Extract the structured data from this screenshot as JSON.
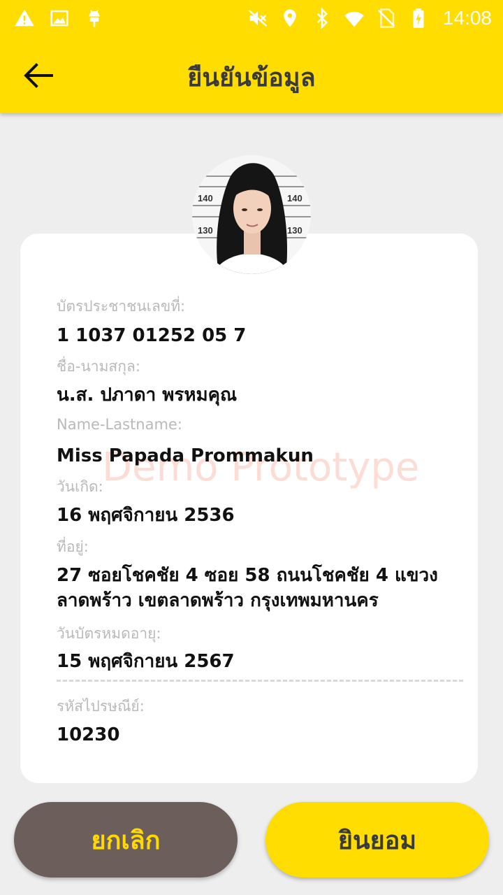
{
  "status_bar": {
    "time": "14:08",
    "left_icons": [
      "warning-icon",
      "image-icon",
      "android-icon"
    ],
    "right_icons": [
      "mute-icon",
      "location-icon",
      "bluetooth-icon",
      "wifi-icon",
      "no-sim-icon",
      "battery-charging-icon"
    ]
  },
  "header": {
    "title": "ยืนยันข้อมูล",
    "back_icon": "arrow-left-icon"
  },
  "profile": {
    "fields": [
      {
        "label": "บัตรประชาชนเลขที่:",
        "value": "1 1037 01252 05 7"
      },
      {
        "label": "ชื่อ-นามสกุล:",
        "value": "น.ส. ปภาดา พรหมคุณ"
      },
      {
        "label": "Name-Lastname:",
        "value": "Miss Papada Prommakun"
      },
      {
        "label": "วันเกิด:",
        "value": "16 พฤศจิกายน 2536"
      },
      {
        "label": "ที่อยู่:",
        "value_line1": "27 ซอยโชคชัย 4 ซอย 58 ถนนโชคชัย 4 แขวง",
        "value_line2": "ลาดพร้าว เขตลาดพร้าว กรุงเทพมหานคร"
      },
      {
        "label": "วันบัตรหมดอายุ:",
        "value": "15 พฤศจิกายน 2567"
      },
      {
        "label": "รหัสไปรษณีย์:",
        "value": "10230"
      }
    ],
    "watermark": "Demo Prototype",
    "photo_marks": [
      "140",
      "140",
      "130",
      "130"
    ]
  },
  "actions": {
    "cancel_label": "ยกเลิก",
    "accept_label": "ยินยอม"
  },
  "colors": {
    "primary_yellow": "#ffdd00",
    "cancel_brown": "#6c5f5b",
    "background": "#eeeeee"
  }
}
